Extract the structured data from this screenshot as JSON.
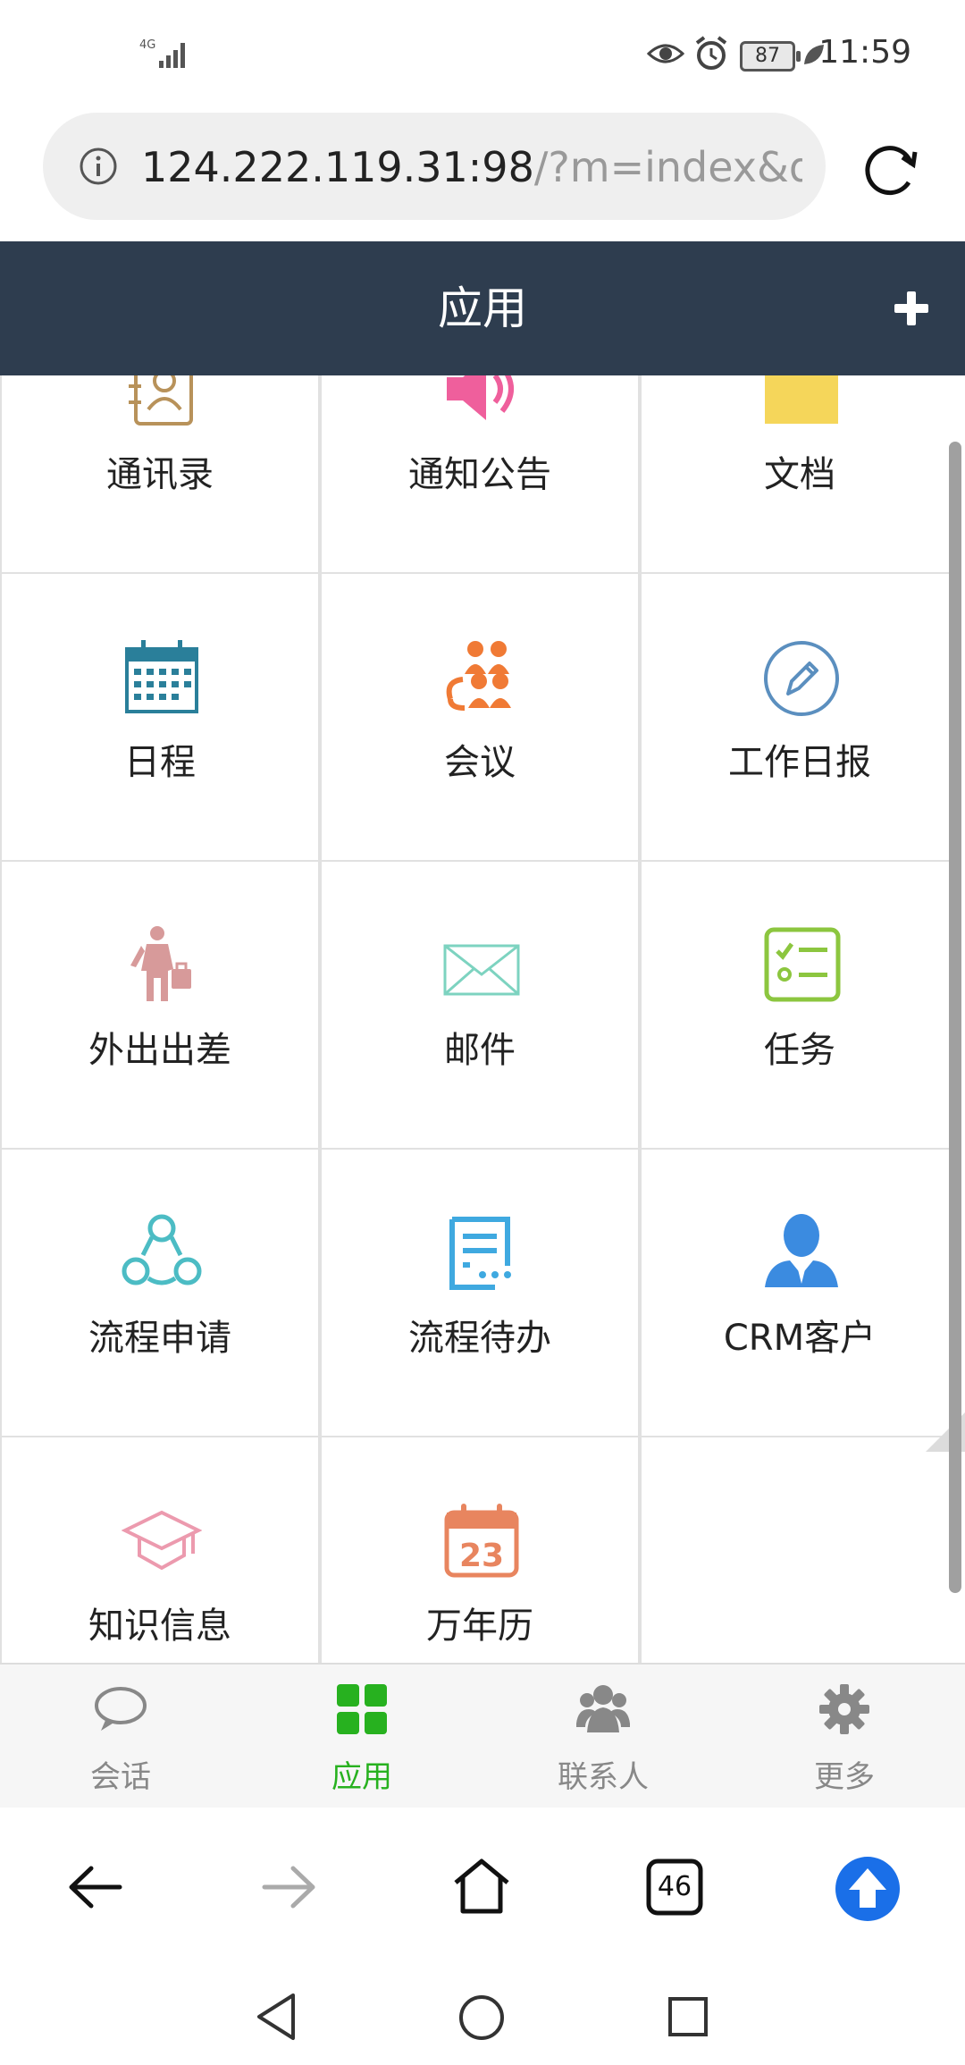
{
  "status_bar": {
    "network": "4G",
    "battery": "87",
    "time": "11:59"
  },
  "browser": {
    "url_main": "124.222.119.31:98",
    "url_rest": "/?m=index&d=w",
    "tab_count": "46"
  },
  "header": {
    "title": "应用"
  },
  "apps": [
    {
      "label": "通讯录",
      "icon": "contacts-icon",
      "color": "#b8925a"
    },
    {
      "label": "通知公告",
      "icon": "speaker-icon",
      "color": "#ef5f9c"
    },
    {
      "label": "文档",
      "icon": "folder-icon",
      "color": "#f5d65a"
    },
    {
      "label": "日程",
      "icon": "calendar-icon",
      "color": "#2a7f9a"
    },
    {
      "label": "会议",
      "icon": "meeting-icon",
      "color": "#f07a35"
    },
    {
      "label": "工作日报",
      "icon": "pencil-icon",
      "color": "#5b8fbf"
    },
    {
      "label": "外出出差",
      "icon": "traveler-icon",
      "color": "#d79a9a"
    },
    {
      "label": "邮件",
      "icon": "mail-icon",
      "color": "#7dd3c0"
    },
    {
      "label": "任务",
      "icon": "checklist-icon",
      "color": "#8cc63f"
    },
    {
      "label": "流程申请",
      "icon": "flow-icon",
      "color": "#4cbcc4"
    },
    {
      "label": "流程待办",
      "icon": "document-list-icon",
      "color": "#3fa9e0"
    },
    {
      "label": "CRM客户",
      "icon": "customer-icon",
      "color": "#3b8be0"
    },
    {
      "label": "知识信息",
      "icon": "graduation-cap-icon",
      "color": "#ec9aae"
    },
    {
      "label": "万年历",
      "icon": "calendar-date-icon",
      "color": "#e8855f",
      "date": "23"
    }
  ],
  "bottom_nav": [
    {
      "label": "会话",
      "icon": "chat-bubble-icon",
      "active": false
    },
    {
      "label": "应用",
      "icon": "apps-grid-icon",
      "active": true
    },
    {
      "label": "联系人",
      "icon": "people-icon",
      "active": false
    },
    {
      "label": "更多",
      "icon": "gear-icon",
      "active": false
    }
  ],
  "colors": {
    "header_bg": "#2e3d4f",
    "active_green": "#27b11f",
    "inactive_gray": "#888888",
    "upload_blue": "#1a6fe8"
  }
}
